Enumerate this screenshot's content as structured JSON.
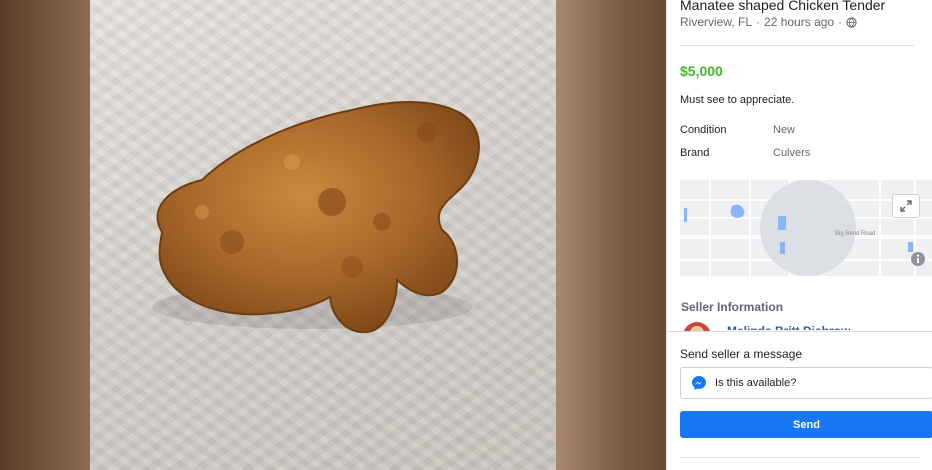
{
  "listing": {
    "title": "Manatee shaped Chicken Tender",
    "location": "Riverview, FL",
    "separator": "·",
    "time_posted": "22 hours ago",
    "price": "$5,000",
    "description": "Must see to appreciate.",
    "details": [
      {
        "label": "Condition",
        "value": "New"
      },
      {
        "label": "Brand",
        "value": "Culvers"
      }
    ]
  },
  "map": {
    "street_label": "Big Bend Road"
  },
  "seller": {
    "header": "Seller Information",
    "name": "Melinda Britt Dishrow"
  },
  "message": {
    "label": "Send seller a message",
    "input_value": "Is this available?",
    "send_label": "Send"
  },
  "colors": {
    "price": "#42b72a",
    "send_button": "#1877f2",
    "seller_name": "#385898"
  },
  "icons": [
    "globe-icon",
    "expand-icon",
    "info-icon",
    "messenger-icon"
  ]
}
